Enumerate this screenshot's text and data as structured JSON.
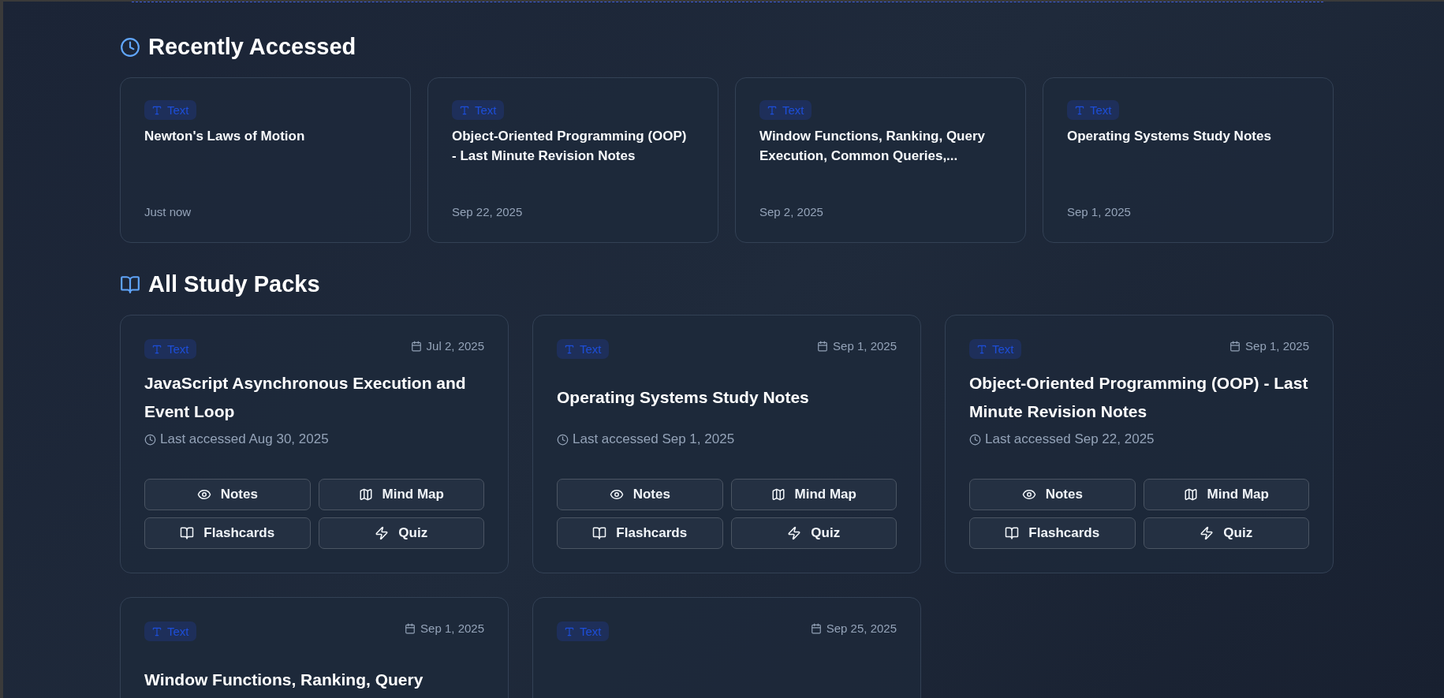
{
  "recently_accessed": {
    "heading": "Recently Accessed",
    "items": [
      {
        "kind": "text",
        "badge": "Text",
        "title": "Newton's Laws of Motion",
        "time": "Just now"
      },
      {
        "kind": "text",
        "badge": "Text",
        "title": "Object-Oriented Programming (OOP) - Last Minute Revision Notes",
        "time": "Sep 22, 2025"
      },
      {
        "kind": "text",
        "badge": "Text",
        "title": "Window Functions, Ranking, Query Execution, Common Queries,...",
        "time": "Sep 2, 2025"
      },
      {
        "kind": "text",
        "badge": "Text",
        "title": "Operating Systems Study Notes",
        "time": "Sep 1, 2025"
      }
    ]
  },
  "study_packs": {
    "heading": "All Study Packs",
    "items": [
      {
        "kind": "text",
        "badge": "Text",
        "date": "Jul 2, 2025",
        "title": "JavaScript Asynchronous Execution and Event Loop",
        "last_accessed": "Last accessed Aug 30, 2025",
        "actions": [
          {
            "kind": "notes",
            "label": "Notes"
          },
          {
            "kind": "mind_map",
            "label": "Mind Map"
          },
          {
            "kind": "flashcards",
            "label": "Flashcards"
          },
          {
            "kind": "quiz",
            "label": "Quiz"
          }
        ]
      },
      {
        "kind": "text",
        "badge": "Text",
        "date": "Sep 1, 2025",
        "title": "Operating Systems Study Notes",
        "last_accessed": "Last accessed Sep 1, 2025",
        "actions": [
          {
            "kind": "notes",
            "label": "Notes"
          },
          {
            "kind": "mind_map",
            "label": "Mind Map"
          },
          {
            "kind": "flashcards",
            "label": "Flashcards"
          },
          {
            "kind": "quiz",
            "label": "Quiz"
          }
        ]
      },
      {
        "kind": "text",
        "badge": "Text",
        "date": "Sep 1, 2025",
        "title": "Object-Oriented Programming (OOP) - Last Minute Revision Notes",
        "last_accessed": "Last accessed Sep 22, 2025",
        "actions": [
          {
            "kind": "notes",
            "label": "Notes"
          },
          {
            "kind": "mind_map",
            "label": "Mind Map"
          },
          {
            "kind": "flashcards",
            "label": "Flashcards"
          },
          {
            "kind": "quiz",
            "label": "Quiz"
          }
        ]
      },
      {
        "kind": "text",
        "badge": "Text",
        "date": "Sep 1, 2025",
        "title": "Window Functions, Ranking, Query"
      },
      {
        "kind": "text",
        "badge": "Text",
        "date": "Sep 25, 2025"
      }
    ]
  }
}
